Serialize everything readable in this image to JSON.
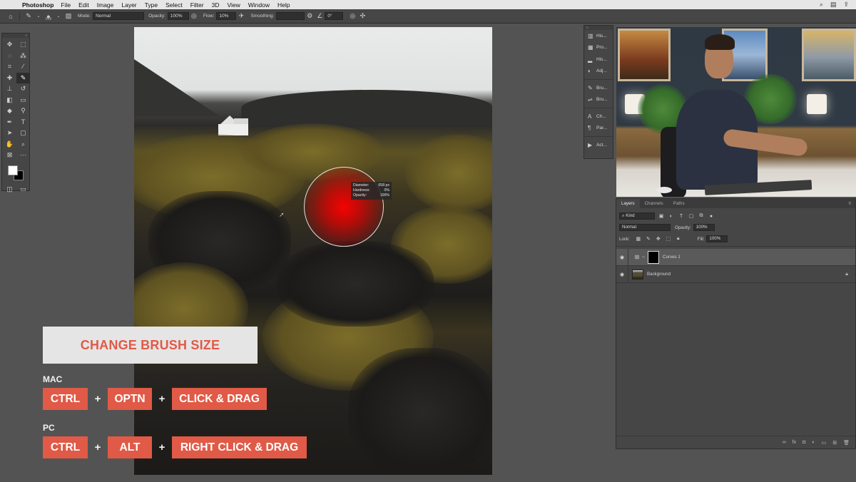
{
  "menubar": {
    "apple": "",
    "app_name": "Photoshop",
    "items": [
      "File",
      "Edit",
      "Image",
      "Layer",
      "Type",
      "Select",
      "Filter",
      "3D",
      "View",
      "Window",
      "Help"
    ]
  },
  "options_bar": {
    "brush_size": "848",
    "mode_label": "Mode:",
    "mode_value": "Normal",
    "opacity_label": "Opacity:",
    "opacity_value": "100%",
    "flow_label": "Flow:",
    "flow_value": "10%",
    "smoothing_label": "Smoothing:",
    "smoothing_value": "",
    "angle_value": "0°"
  },
  "brush_tooltip": {
    "diameter_label": "Diameter:",
    "diameter_value": "658 px",
    "hardness_label": "Hardness:",
    "hardness_value": "0%",
    "opacity_label": "Opacity:",
    "opacity_value": "100%"
  },
  "mini_panels": [
    "His...",
    "Pro...",
    "His...",
    "Adj...",
    "Bru...",
    "Bru...",
    "Ch...",
    "Par...",
    "Act..."
  ],
  "layers_panel": {
    "tabs": [
      "Layers",
      "Channels",
      "Paths"
    ],
    "filter_kind": "Kind",
    "blend_mode": "Normal",
    "opacity_label": "Opacity:",
    "opacity_value": "100%",
    "lock_label": "Lock:",
    "fill_label": "Fill:",
    "fill_value": "100%",
    "layers": [
      {
        "name": "Curves 1",
        "selected": true
      },
      {
        "name": "Background",
        "selected": false
      }
    ]
  },
  "overlay": {
    "title": "CHANGE BRUSH SIZE",
    "mac_label": "MAC",
    "mac_keys": [
      "CTRL",
      "OPTN",
      "CLICK & DRAG"
    ],
    "pc_label": "PC",
    "pc_keys": [
      "CTRL",
      "ALT",
      "RIGHT CLICK & DRAG"
    ],
    "plus": "+"
  },
  "colors": {
    "accent": "#e05a47",
    "panel": "#464646",
    "workspace": "#535353",
    "title_card": "#e5e5e5"
  }
}
